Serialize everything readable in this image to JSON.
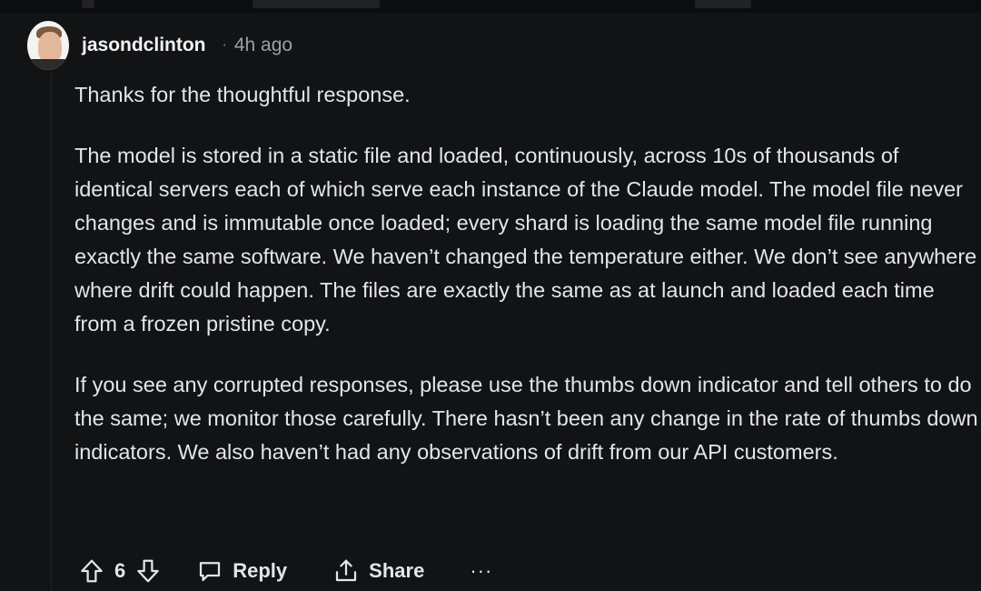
{
  "comment": {
    "username": "jasondclinton",
    "separator": "·",
    "time": "4h ago",
    "paragraphs": [
      "Thanks for the thoughtful response.",
      "The model is stored in a static file and loaded, continuously, across 10s of thousands of identical servers each of which serve each instance of the Claude model. The model file never changes and is immutable once loaded; every shard is loading the same model file running exactly the same software. We haven’t changed the temperature either. We don’t see anywhere where drift could happen. The files are exactly the same as at launch and loaded each time from a frozen pristine copy.",
      "If you see any corrupted responses, please use the thumbs down indicator and tell others to do the same; we monitor those carefully. There hasn’t been any change in the rate of thumbs down indicators. We also haven’t had any observations of drift from our API customers."
    ],
    "actions": {
      "vote_count": "6",
      "reply_label": "Reply",
      "share_label": "Share",
      "more_label": "···"
    }
  },
  "icons": {
    "upvote": "arrow-up-icon",
    "downvote": "arrow-down-icon",
    "reply": "speech-bubble-icon",
    "share": "share-icon",
    "more": "more-horizontal-icon"
  },
  "colors": {
    "background": "#111315",
    "text": "#e3e5e8",
    "muted": "#9aa0a6"
  }
}
